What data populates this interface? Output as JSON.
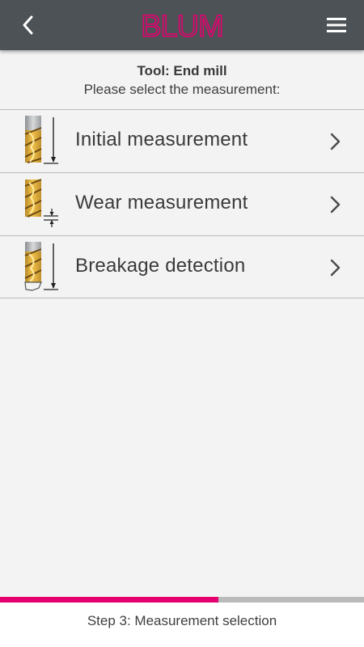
{
  "header": {
    "logo_text": "BLUM",
    "back_icon": "back-chevron-icon",
    "menu_icon": "hamburger-menu-icon",
    "background_color": "#4d5256",
    "logo_color": "#e4006f"
  },
  "intro": {
    "title": "Tool: End mill",
    "subtitle": "Please select the measurement:"
  },
  "measurements": [
    {
      "label": "Initial measurement",
      "icon": "end-mill-initial-measurement-icon"
    },
    {
      "label": "Wear measurement",
      "icon": "end-mill-wear-measurement-icon"
    },
    {
      "label": "Breakage detection",
      "icon": "end-mill-breakage-detection-icon"
    }
  ],
  "progress": {
    "fraction": 0.6,
    "fill_color": "#e4006f",
    "track_color": "#b8babb"
  },
  "footer": {
    "step_text": "Step 3: Measurement selection"
  }
}
